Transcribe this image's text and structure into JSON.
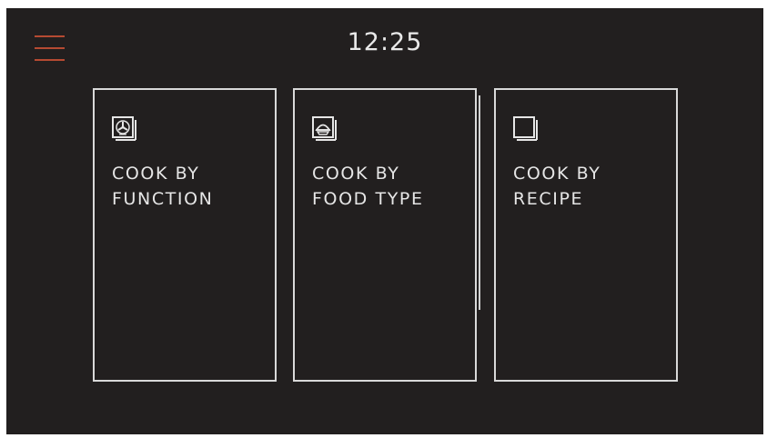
{
  "header": {
    "time": "12:25"
  },
  "menu": {
    "icon": "hamburger-menu-icon",
    "color": "#b64a32"
  },
  "cards": [
    {
      "icon": "fan-icon",
      "line1": "COOK BY",
      "line2": "FUNCTION"
    },
    {
      "icon": "food-dish-icon",
      "line1": "COOK BY",
      "line2": "FOOD TYPE"
    },
    {
      "icon": "recipe-book-icon",
      "line1": "COOK BY",
      "line2": "RECIPE"
    }
  ],
  "colors": {
    "background": "#221f1f",
    "text": "#e6e6e6",
    "border": "#d9d9d9",
    "accent": "#b64a32"
  }
}
